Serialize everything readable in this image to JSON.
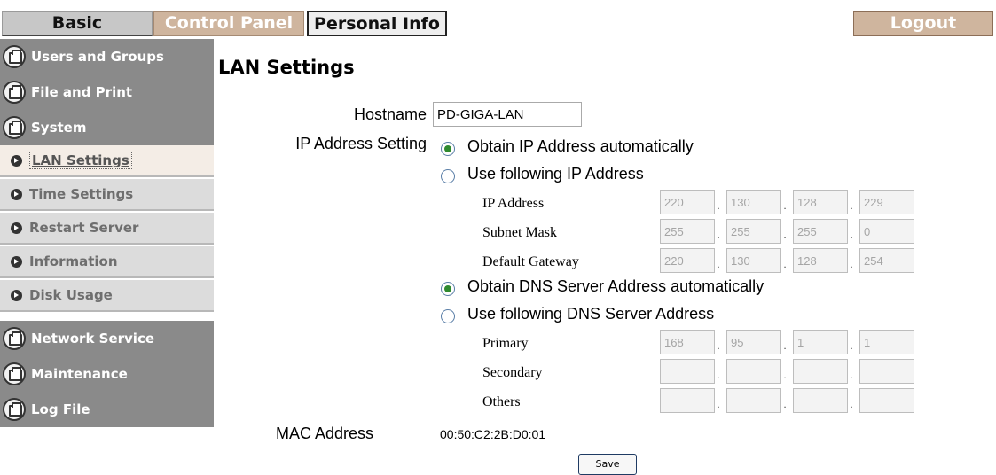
{
  "tabs": {
    "basic": "Basic",
    "control_panel": "Control Panel",
    "personal_info": "Personal Info",
    "logout": "Logout"
  },
  "sidebar": {
    "items": [
      {
        "label": "Users and Groups",
        "type": "main",
        "icon": "folder-icon"
      },
      {
        "label": "File and Print",
        "type": "main",
        "icon": "folder-icon"
      },
      {
        "label": "System",
        "type": "main",
        "icon": "folder-icon"
      },
      {
        "label": "LAN Settings",
        "type": "sub",
        "icon": "bullet-arrow-icon",
        "active": true
      },
      {
        "label": "Time Settings",
        "type": "sub",
        "icon": "bullet-arrow-icon"
      },
      {
        "label": "Restart Server",
        "type": "sub",
        "icon": "bullet-arrow-icon"
      },
      {
        "label": "Information",
        "type": "sub",
        "icon": "bullet-arrow-icon"
      },
      {
        "label": "Disk Usage",
        "type": "sub",
        "icon": "bullet-arrow-icon"
      },
      {
        "label": "Network Service",
        "type": "main",
        "icon": "folder-icon"
      },
      {
        "label": "Maintenance",
        "type": "main",
        "icon": "folder-icon"
      },
      {
        "label": "Log File",
        "type": "main",
        "icon": "folder-icon"
      }
    ]
  },
  "main": {
    "title": "LAN Settings",
    "hostname_label": "Hostname",
    "hostname_value": "PD-GIGA-LAN",
    "ip_setting_label": "IP Address Setting",
    "ip_auto_label": "Obtain IP Address automatically",
    "ip_manual_label": "Use following IP Address",
    "ip_auto_selected": true,
    "ip_fields": [
      {
        "label": "IP Address",
        "octets": [
          "220",
          "130",
          "128",
          "229"
        ]
      },
      {
        "label": "Subnet Mask",
        "octets": [
          "255",
          "255",
          "255",
          "0"
        ]
      },
      {
        "label": "Default Gateway",
        "octets": [
          "220",
          "130",
          "128",
          "254"
        ]
      }
    ],
    "dns_auto_label": "Obtain DNS Server Address automatically",
    "dns_manual_label": "Use following DNS Server Address",
    "dns_auto_selected": true,
    "dns_fields": [
      {
        "label": "Primary",
        "octets": [
          "168",
          "95",
          "1",
          "1"
        ]
      },
      {
        "label": "Secondary",
        "octets": [
          "",
          "",
          "",
          ""
        ]
      },
      {
        "label": "Others",
        "octets": [
          "",
          "",
          "",
          ""
        ]
      }
    ],
    "mac_label": "MAC Address",
    "mac_value": "00:50:C2:2B:D0:01",
    "save_label": "Save"
  }
}
